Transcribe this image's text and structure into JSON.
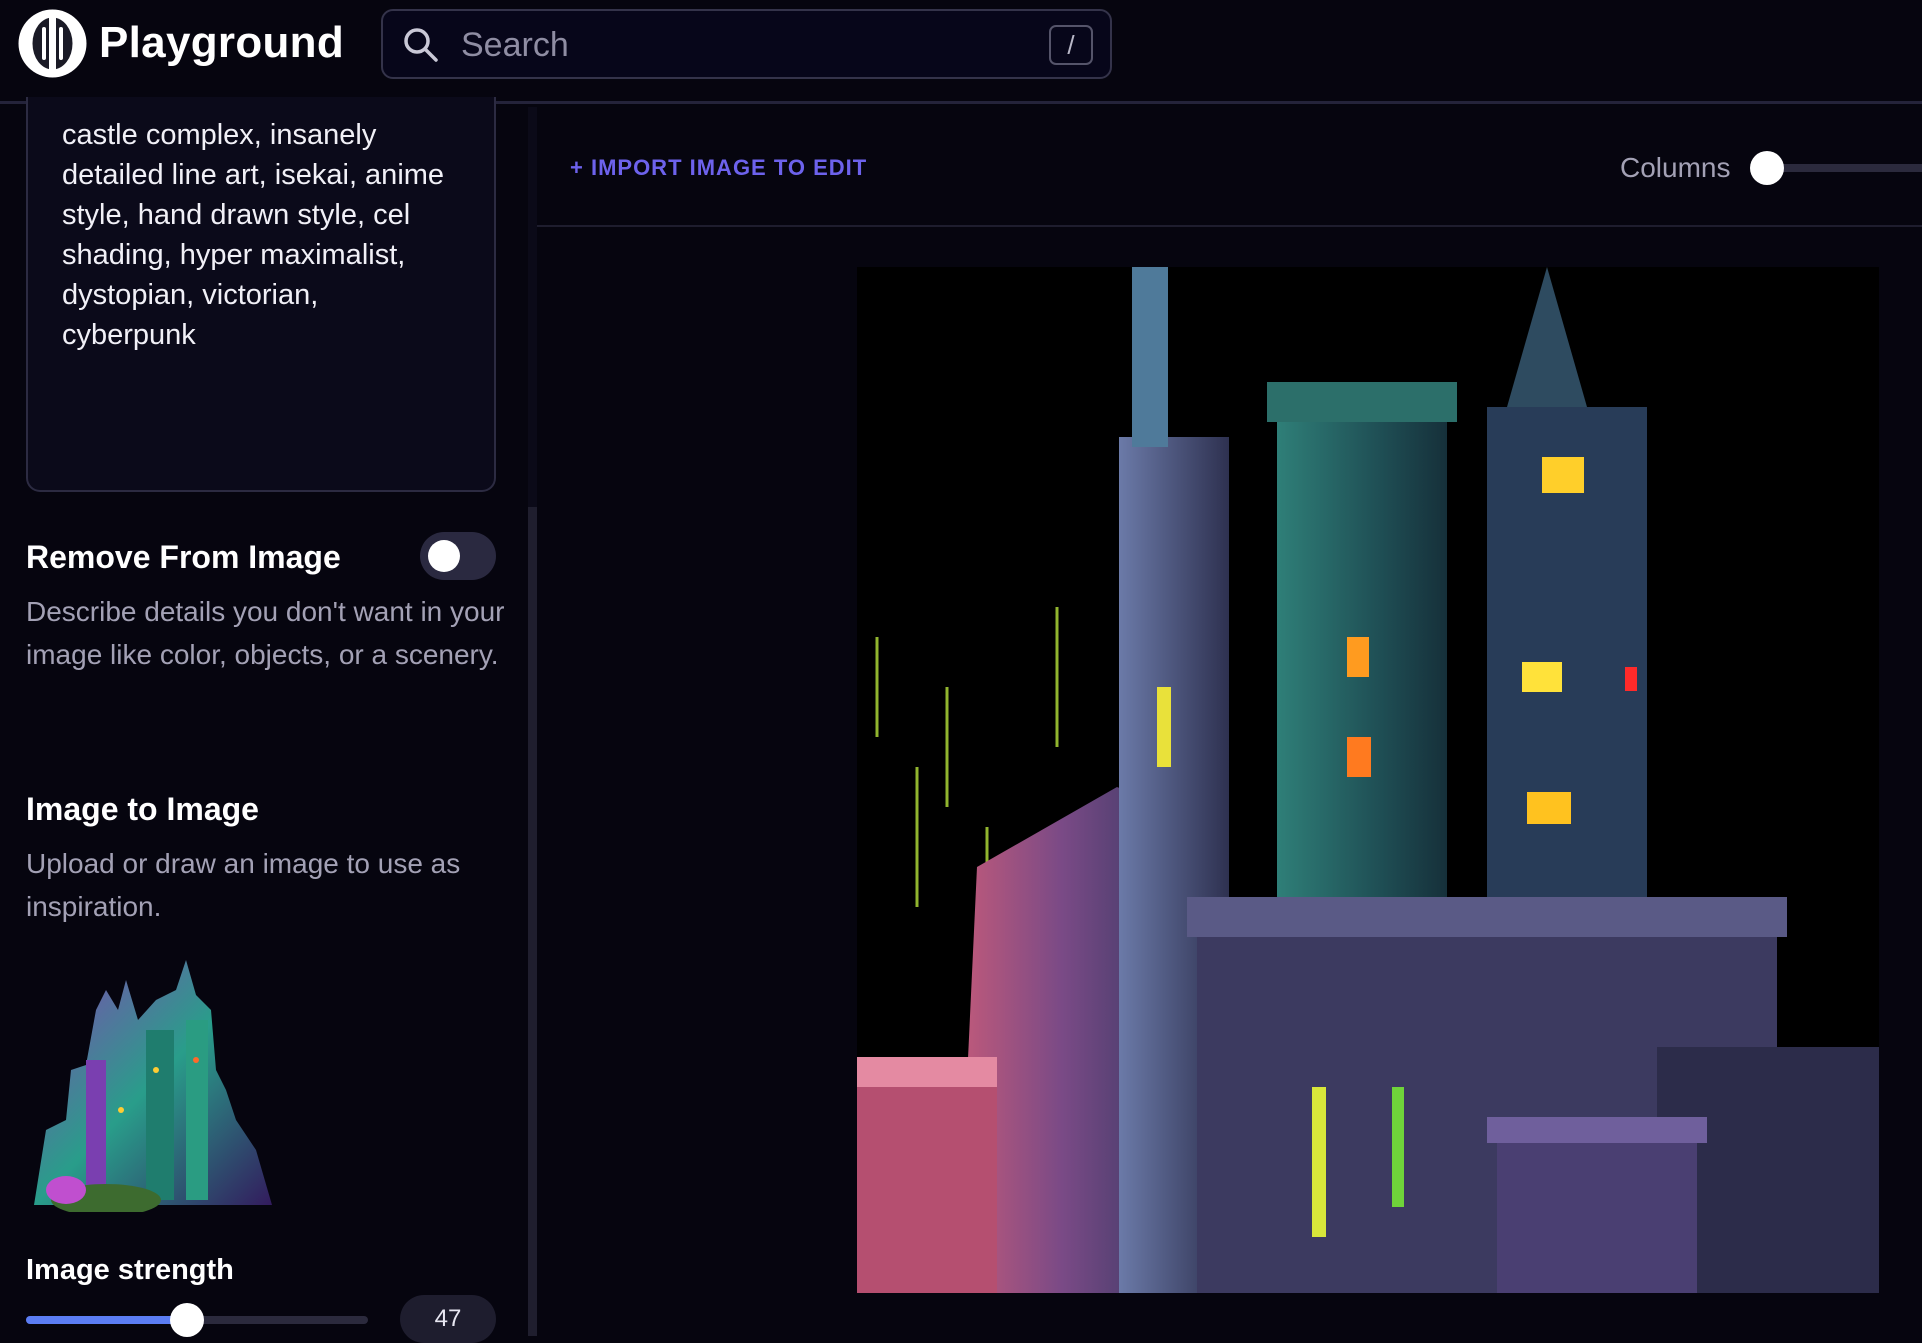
{
  "app": {
    "title": "Playground",
    "logo_icon": "playground-logo-icon"
  },
  "search": {
    "placeholder": "Search",
    "shortcut": "/",
    "icon": "search-icon"
  },
  "sidebar": {
    "prompt_text": "castle complex, insanely\ndetailed line art, isekai, anime\nstyle, hand drawn style, cel\nshading, hyper maximalist,\ndystopian, victorian,\ncyberpunk",
    "remove_from_image": {
      "title": "Remove From Image",
      "description": "Describe details you don't want in your image like color, objects, or a scenery.",
      "toggle_on": false
    },
    "image_to_image": {
      "title": "Image to Image",
      "description": "Upload or draw an image to use as inspiration."
    },
    "image_strength": {
      "label": "Image strength",
      "value": "47",
      "fraction": 0.47
    }
  },
  "toolbar": {
    "import_label": "+ IMPORT IMAGE TO EDIT",
    "columns_label": "Columns"
  },
  "colors": {
    "background": "#06050f",
    "accent": "#6d62ec",
    "slider_fill": "#5b7df4"
  }
}
